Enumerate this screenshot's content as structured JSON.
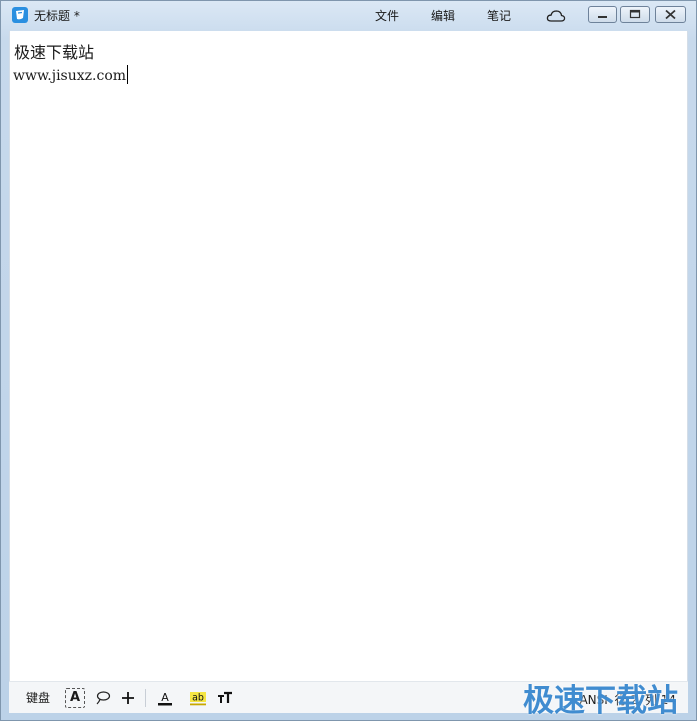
{
  "window": {
    "title": "无标题 *"
  },
  "menu": {
    "file": "文件",
    "edit": "编辑",
    "notes": "笔记"
  },
  "editor": {
    "line1": "极速下载站",
    "line2": "www.jisuxz.com"
  },
  "toolbar": {
    "keyboard": "键盘",
    "textbox_glyph": "A",
    "font_color_glyph": "A",
    "highlight_glyph": "ab",
    "font_size_glyph": "тT"
  },
  "statusbar": {
    "encoding": "ANSI",
    "line": "行 2",
    "column": "列 14"
  },
  "watermark": {
    "text": "极速下载站"
  },
  "colors": {
    "accent": "#2a8fe0",
    "highlight": "#f5e642",
    "watermark": "#1e78c8"
  }
}
